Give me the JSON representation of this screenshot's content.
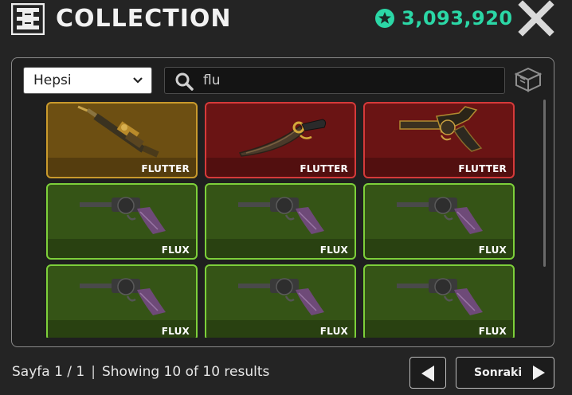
{
  "header": {
    "title": "COLLECTION",
    "logo_icon": "collection-grid-icon",
    "currency_icon": "star-coin-icon",
    "currency_amount": "3,093,920",
    "close_icon": "close-icon"
  },
  "toolbar": {
    "filter_value": "Hepsi",
    "search_value": "flu",
    "search_icon": "search-icon",
    "box_icon": "crate-icon"
  },
  "items": [
    {
      "label": "FLUTTER",
      "rarity": "gold",
      "icon": "flutter-rifle-icon"
    },
    {
      "label": "FLUTTER",
      "rarity": "red",
      "icon": "flutter-machete-icon"
    },
    {
      "label": "FLUTTER",
      "rarity": "red",
      "icon": "flutter-revolver-icon"
    },
    {
      "label": "FLUX",
      "rarity": "green",
      "icon": "flux-revolver-icon"
    },
    {
      "label": "FLUX",
      "rarity": "green",
      "icon": "flux-revolver-icon"
    },
    {
      "label": "FLUX",
      "rarity": "green",
      "icon": "flux-revolver-icon"
    },
    {
      "label": "FLUX",
      "rarity": "green",
      "icon": "flux-revolver-icon"
    },
    {
      "label": "FLUX",
      "rarity": "green",
      "icon": "flux-revolver-icon"
    },
    {
      "label": "FLUX",
      "rarity": "green",
      "icon": "flux-revolver-icon"
    }
  ],
  "footer": {
    "page_text": "Sayfa 1 / 1",
    "separator": "|",
    "results_text": "Showing 10 of 10 results",
    "prev_icon": "arrow-left-icon",
    "next_label": "Sonraki",
    "next_icon": "arrow-right-icon"
  },
  "colors": {
    "accent": "#2bd7a6",
    "gold": "#c99a2c",
    "red": "#d63a3a",
    "green": "#7dd03a"
  }
}
